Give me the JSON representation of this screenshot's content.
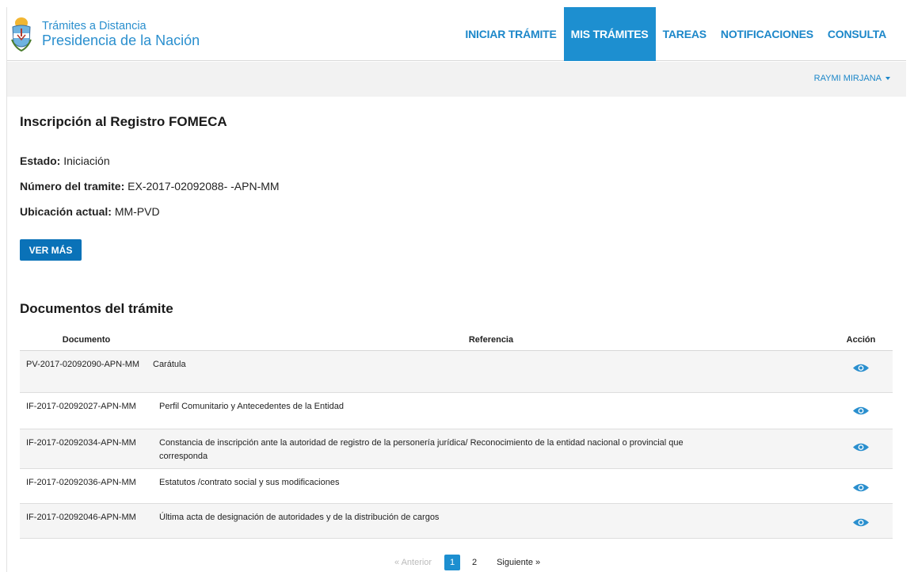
{
  "brand": {
    "line1": "Trámites a Distancia",
    "line2": "Presidencia de la Nación"
  },
  "nav": {
    "items": [
      {
        "label": "INICIAR TRÁMITE",
        "active": false
      },
      {
        "label": "MIS TRÁMITES",
        "active": true
      },
      {
        "label": "TAREAS",
        "active": false
      },
      {
        "label": "NOTIFICACIONES",
        "active": false
      },
      {
        "label": "CONSULTA",
        "active": false
      }
    ]
  },
  "user": {
    "name": "RAYMI MIRJANA"
  },
  "tramite": {
    "title": "Inscripción al Registro FOMECA",
    "estado_label": "Estado:",
    "estado_value": "Iniciación",
    "numero_label": "Número del tramite:",
    "numero_value": "EX-2017-02092088- -APN-MM",
    "ubicacion_label": "Ubicación actual:",
    "ubicacion_value": "MM-PVD",
    "ver_mas_label": "VER MÁS"
  },
  "documentos": {
    "title": "Documentos del trámite",
    "columns": {
      "documento": "Documento",
      "referencia": "Referencia",
      "accion": "Acción"
    },
    "rows": [
      {
        "documento": "PV-2017-02092090-APN-MM",
        "referencia": "Carátula"
      },
      {
        "documento": "IF-2017-02092027-APN-MM",
        "referencia": "Perfil Comunitario y Antecedentes de la Entidad"
      },
      {
        "documento": "IF-2017-02092034-APN-MM",
        "referencia": "Constancia de inscripción ante la autoridad de registro de la personería jurídica/ Reconocimiento de la entidad nacional o provincial que corresponda"
      },
      {
        "documento": "IF-2017-02092036-APN-MM",
        "referencia": "Estatutos /contrato social y sus modificaciones"
      },
      {
        "documento": "IF-2017-02092046-APN-MM",
        "referencia": "Última acta de designación de autoridades y de la distribución de cargos"
      }
    ],
    "action_icon": "eye-icon"
  },
  "pagination": {
    "prev_label": "« Anterior",
    "pages": [
      "1",
      "2"
    ],
    "current": "1",
    "next_label": "Siguiente »"
  },
  "colors": {
    "brand_blue": "#2a8fce",
    "nav_active": "#1d8fd0",
    "button": "#0a72b8"
  }
}
